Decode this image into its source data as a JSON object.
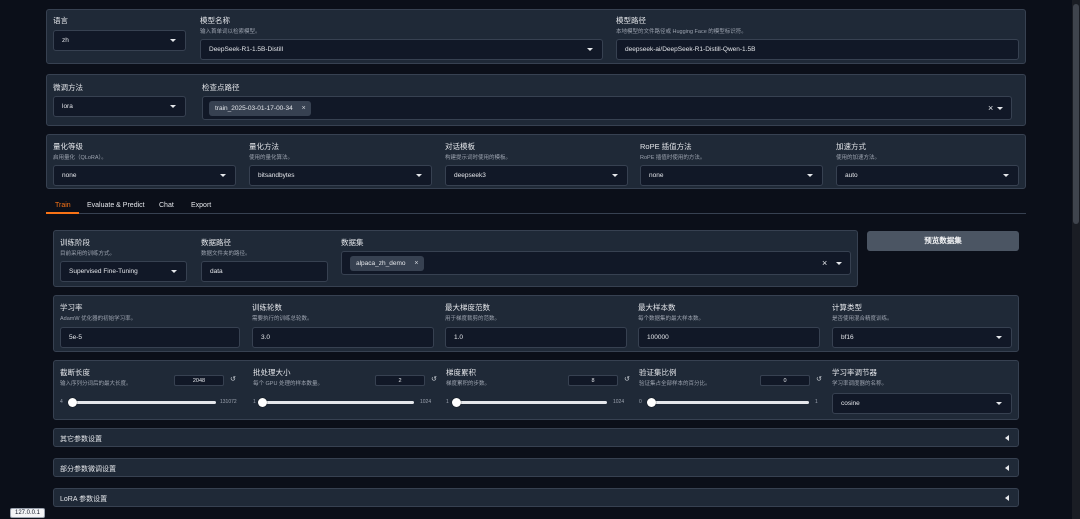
{
  "top": {
    "lang_label": "语言",
    "lang_value": "zh",
    "model_name_label": "模型名称",
    "model_name_info": "输入首单词以检索模型。",
    "model_name_value": "DeepSeek-R1-1.5B-Distill",
    "model_path_label": "模型路径",
    "model_path_info": "本地模型的文件路径或 Hugging Face 的模型标识符。",
    "model_path_value": "deepseek-ai/DeepSeek-R1-Distill-Qwen-1.5B"
  },
  "finetune": {
    "method_label": "微调方法",
    "method_value": "lora",
    "ckpt_label": "检查点路径",
    "ckpt_chip": "train_2025-03-01-17-00-34",
    "chip_x": "×",
    "clear": "×"
  },
  "advanced": {
    "quant_label": "量化等级",
    "quant_info": "启用量化（QLoRA）。",
    "quant_value": "none",
    "qmethod_label": "量化方法",
    "qmethod_info": "使用的量化算法。",
    "qmethod_value": "bitsandbytes",
    "template_label": "对话模板",
    "template_info": "构建提示词时使用的模板。",
    "template_value": "deepseek3",
    "rope_label": "RoPE 插值方法",
    "rope_info": "RoPE 插值时使用的方法。",
    "rope_value": "none",
    "booster_label": "加速方式",
    "booster_info": "使用的加速方法。",
    "booster_value": "auto"
  },
  "tabs": [
    "Train",
    "Evaluate & Predict",
    "Chat",
    "Export"
  ],
  "train": {
    "stage_label": "训练阶段",
    "stage_info": "目前采用的训练方式。",
    "stage_value": "Supervised Fine-Tuning",
    "dataset_dir_label": "数据路径",
    "dataset_dir_info": "数据文件夹的路径。",
    "dataset_dir_value": "data",
    "dataset_label": "数据集",
    "dataset_chip": "alpaca_zh_demo",
    "preview_button": "预览数据集"
  },
  "hparams": {
    "lr_label": "学习率",
    "lr_info": "AdamW 优化器的初始学习率。",
    "lr_value": "5e-5",
    "epochs_label": "训练轮数",
    "epochs_info": "需要执行的训练总轮数。",
    "epochs_value": "3.0",
    "grad_label": "最大梯度范数",
    "grad_info": "用于梯度裁剪的范数。",
    "grad_value": "1.0",
    "samples_label": "最大样本数",
    "samples_info": "每个数据集的最大样本数。",
    "samples_value": "100000",
    "compute_label": "计算类型",
    "compute_info": "是否使用混合精度训练。",
    "compute_value": "bf16"
  },
  "sliders": {
    "cutoff": {
      "label": "截断长度",
      "info": "输入序列分词后的最大长度。",
      "value": "2048",
      "min": "4",
      "max": "131072",
      "fraction": 0.0156
    },
    "batch": {
      "label": "批处理大小",
      "info": "每个 GPU 处理的样本数量。",
      "value": "2",
      "min": "1",
      "max": "1024",
      "fraction": 0.001
    },
    "accum": {
      "label": "梯度累积",
      "info": "梯度累积的步数。",
      "value": "8",
      "min": "1",
      "max": "1024",
      "fraction": 0.007
    },
    "val": {
      "label": "验证集比例",
      "info": "验证集占全部样本的百分比。",
      "value": "0",
      "min": "0",
      "max": "1",
      "fraction": 0.0
    },
    "reset_icon": "↺",
    "scheduler_label": "学习率调节器",
    "scheduler_info": "学习率调度器的名称。",
    "scheduler_value": "cosine"
  },
  "accordions": [
    "其它参数设置",
    "部分参数微调设置",
    "LoRA 参数设置"
  ],
  "status_url": "127.0.0.1"
}
